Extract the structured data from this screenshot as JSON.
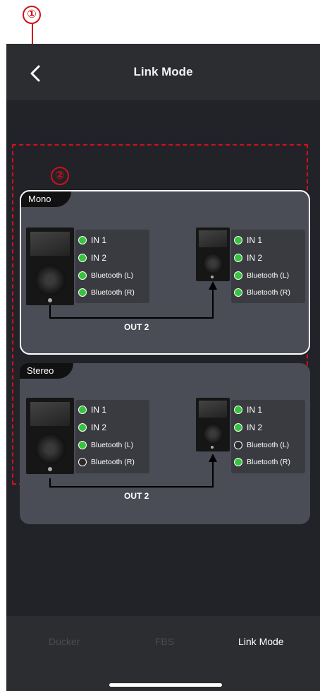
{
  "header": {
    "title": "Link Mode"
  },
  "callouts": {
    "one": "①",
    "two": "②"
  },
  "mono": {
    "label": "Mono",
    "left_speaker": [
      {
        "label": "IN 1",
        "on": true
      },
      {
        "label": "IN 2",
        "on": true
      },
      {
        "label": "Bluetooth (L)",
        "on": true
      },
      {
        "label": "Bluetooth (R)",
        "on": true
      }
    ],
    "right_speaker": [
      {
        "label": "IN 1",
        "on": true
      },
      {
        "label": "IN 2",
        "on": true
      },
      {
        "label": "Bluetooth (L)",
        "on": true
      },
      {
        "label": "Bluetooth (R)",
        "on": true
      }
    ],
    "out_label": "OUT 2"
  },
  "stereo": {
    "label": "Stereo",
    "left_speaker": [
      {
        "label": "IN 1",
        "on": true
      },
      {
        "label": "IN 2",
        "on": true
      },
      {
        "label": "Bluetooth (L)",
        "on": true
      },
      {
        "label": "Bluetooth (R)",
        "on": false
      }
    ],
    "right_speaker": [
      {
        "label": "IN 1",
        "on": true
      },
      {
        "label": "IN 2",
        "on": true
      },
      {
        "label": "Bluetooth (L)",
        "on": false
      },
      {
        "label": "Bluetooth (R)",
        "on": true
      }
    ],
    "out_label": "OUT 2"
  },
  "tabs": [
    {
      "label": "Ducker",
      "active": false
    },
    {
      "label": "FBS",
      "active": false
    },
    {
      "label": "Link Mode",
      "active": true
    }
  ],
  "colors": {
    "accent": "#d0101a",
    "led_on": "#35c43c",
    "led_off": "#2a2a2a"
  }
}
